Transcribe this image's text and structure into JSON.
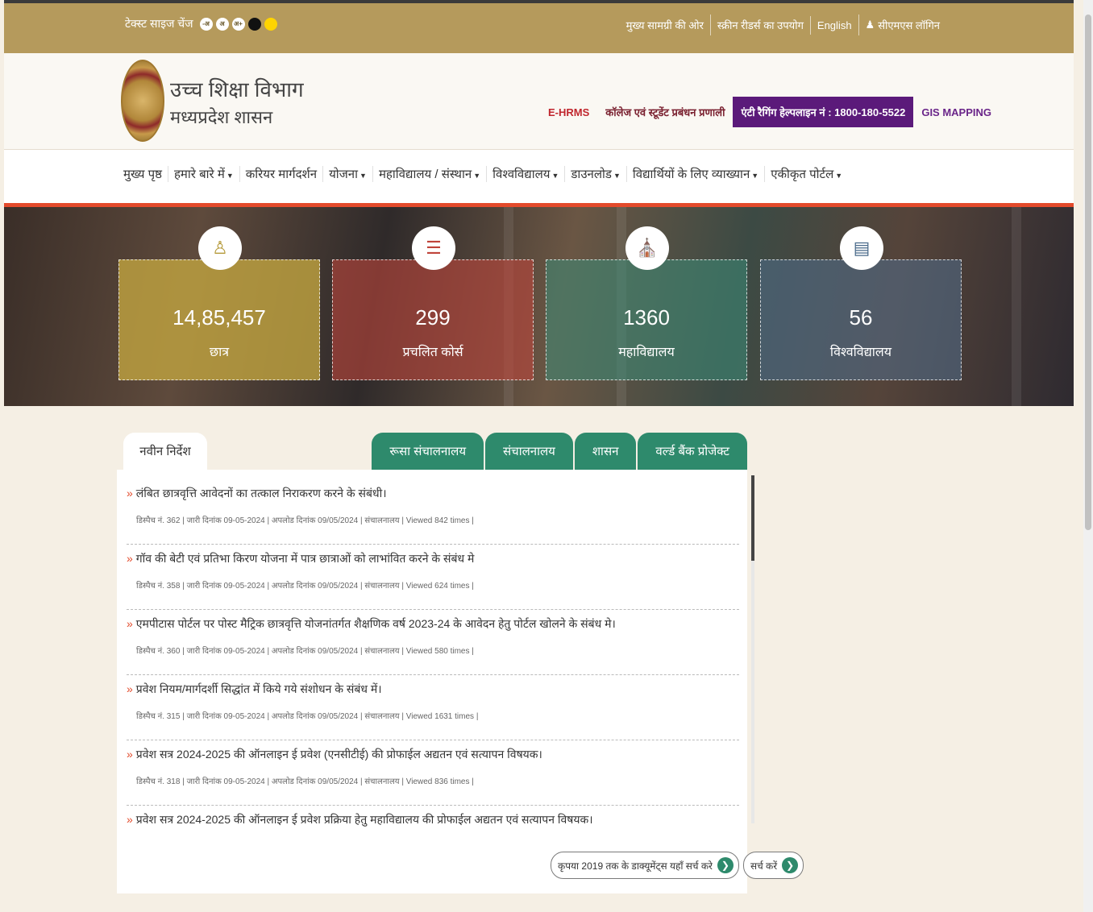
{
  "topbar": {
    "text_size_label": "टेक्स्ट साइज चेंज",
    "text_size_buttons": [
      "-अ",
      "अ",
      "अ+"
    ],
    "links": [
      "मुख्य सामग्री की ओर",
      "स्क्रीन रीडर्स का उपयोग",
      "English",
      "सीएमएस लॉगिन"
    ]
  },
  "header": {
    "title": "उच्च शिक्षा विभाग",
    "subtitle": "मध्यप्रदेश शासन",
    "ehrms": "E-HRMS",
    "college_mgmt": "कॉलेज एवं स्टूडेंट प्रबंधन प्रणाली",
    "helpline": "एंटी रैगिंग हेल्पलाइन नं : 1800-180-5522",
    "gis": "GIS MAPPING"
  },
  "nav": {
    "items": [
      {
        "label": "मुख्य पृष्ठ",
        "dropdown": false
      },
      {
        "label": "हमारे बारे में",
        "dropdown": true
      },
      {
        "label": "करियर मार्गदर्शन",
        "dropdown": false
      },
      {
        "label": "योजना",
        "dropdown": true
      },
      {
        "label": "महाविद्यालय / संस्थान",
        "dropdown": true
      },
      {
        "label": "विश्वविद्यालय",
        "dropdown": true
      },
      {
        "label": "डाउनलोड",
        "dropdown": true
      },
      {
        "label": "विद्यार्थियों के लिए व्याख्यान",
        "dropdown": true
      },
      {
        "label": "एकीकृत पोर्टल",
        "dropdown": true
      }
    ]
  },
  "stats": [
    {
      "value": "14,85,457",
      "label": "छात्र",
      "icon": "student-icon"
    },
    {
      "value": "299",
      "label": "प्रचलित कोर्स",
      "icon": "books-icon"
    },
    {
      "value": "1360",
      "label": "महाविद्यालय",
      "icon": "college-icon"
    },
    {
      "value": "56",
      "label": "विश्वविद्यालय",
      "icon": "university-icon"
    }
  ],
  "tabs": {
    "left": "नवीन निर्देश",
    "right": [
      "रूसा संचालनालय",
      "संचालनालय",
      "शासन",
      "वर्ल्ड बैंक प्रोजेक्ट"
    ]
  },
  "news": [
    {
      "title": "लंबित छात्रवृत्ति आवेदनों का तत्काल निराकरण करने के संबंधी।",
      "meta": "डिस्पैच नं. 362 | जारी दिनांक 09-05-2024 | अपलोड दिनांक 09/05/2024 | संचालनालय | Viewed 842 times |"
    },
    {
      "title": "गॉव की बेटी एवं प्रतिभा किरण योजना में पात्र छात्राओं को लाभांवित करने के संबंध मे",
      "meta": "डिस्पैच नं. 358 | जारी दिनांक 09-05-2024 | अपलोड दिनांक 09/05/2024 | संचालनालय | Viewed 624 times |"
    },
    {
      "title": "एमपीटास पोर्टल पर पोस्ट मैट्रिक छात्रवृत्ति योजनांतर्गत शैक्षणिक वर्ष 2023-24 के आवेदन हेतु पोर्टल खोलने के संबंध मे।",
      "meta": "डिस्पैच नं. 360 | जारी दिनांक 09-05-2024 | अपलोड दिनांक 09/05/2024 | संचालनालय | Viewed 580 times |"
    },
    {
      "title": "प्रवेश नियम/मार्गदर्शी सिद्धांत में किये गये संशोधन के संबंध में।",
      "meta": "डिस्पैच नं. 315 | जारी दिनांक 09-05-2024 | अपलोड दिनांक 09/05/2024 | संचालनालय | Viewed 1631 times |"
    },
    {
      "title": "प्रवेश सत्र 2024-2025 की ऑनलाइन ई प्रवेश (एनसीटीई) की प्रोफाईल अद्यतन एवं सत्यापन विषयक।",
      "meta": "डिस्पैच नं. 318 | जारी दिनांक 09-05-2024 | अपलोड दिनांक 09/05/2024 | संचालनालय | Viewed 836 times |"
    },
    {
      "title": "प्रवेश सत्र 2024-2025 की ऑनलाइन ई प्रवेश प्रक्रिया हेतु महाविद्यालय की प्रोफाईल अद्यतन एवं सत्यापन विषयक।",
      "meta": ""
    }
  ],
  "buttons": {
    "search_old": "कृपया 2019 तक के डाक्यूमेंट्स यहाँ सर्च करे",
    "search": "सर्च करें"
  }
}
